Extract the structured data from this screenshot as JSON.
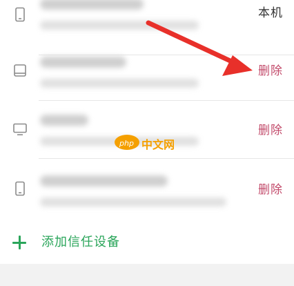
{
  "devices": [
    {
      "icon": "phone-icon",
      "action": "本机",
      "action_type": "local"
    },
    {
      "icon": "tablet-icon",
      "action": "删除",
      "action_type": "delete"
    },
    {
      "icon": "monitor-icon",
      "action": "删除",
      "action_type": "delete"
    },
    {
      "icon": "phone-icon",
      "action": "删除",
      "action_type": "delete"
    }
  ],
  "add_trusted_device": {
    "icon": "plus-icon",
    "label": "添加信任设备"
  },
  "watermark": {
    "logo_text": "php",
    "text": "中文网"
  },
  "colors": {
    "delete": "#c24a6a",
    "add": "#2aa55a",
    "arrow": "#e8302a"
  }
}
